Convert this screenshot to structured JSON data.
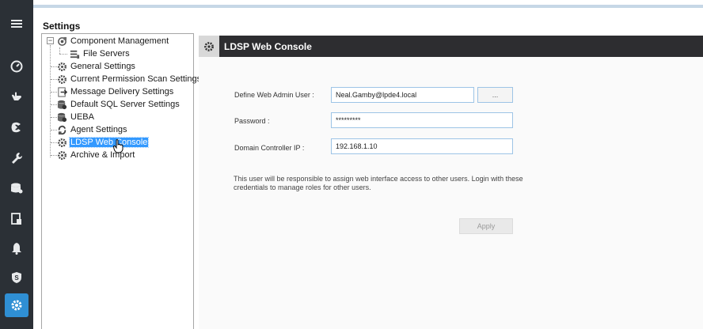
{
  "rail": {
    "items": [
      {
        "name": "menu-icon"
      },
      {
        "name": "dashboard-icon"
      },
      {
        "name": "hand-icon"
      },
      {
        "name": "scan-icon"
      },
      {
        "name": "wrench-icon"
      },
      {
        "name": "database-icon"
      },
      {
        "name": "report-icon"
      },
      {
        "name": "alert-bell-icon"
      },
      {
        "name": "shield-icon"
      },
      {
        "name": "settings-gear-icon",
        "active": true
      }
    ]
  },
  "header": {
    "title": "Settings"
  },
  "tree": {
    "items": [
      {
        "label": "Component Management",
        "icon": "component-icon"
      },
      {
        "label": "File Servers",
        "icon": "file-server-icon"
      },
      {
        "label": "General Settings",
        "icon": "gear-icon"
      },
      {
        "label": "Current Permission Scan Settings",
        "icon": "gear-icon"
      },
      {
        "label": "Message Delivery Settings",
        "icon": "message-icon"
      },
      {
        "label": "Default SQL Server Settings",
        "icon": "database-gear-icon"
      },
      {
        "label": "UEBA",
        "icon": "database-gear-icon"
      },
      {
        "label": "Agent Settings",
        "icon": "agent-icon"
      },
      {
        "label": "LDSP Web Console",
        "icon": "gear-icon",
        "selected": true
      },
      {
        "label": "Archive & Import",
        "icon": "gear-icon"
      }
    ]
  },
  "panel": {
    "title": "LDSP Web Console",
    "admin_user_label": "Define Web Admin User :",
    "admin_user_value": "Neal.Gamby@lpde4.local",
    "browse_label": "...",
    "password_label": "Password :",
    "password_value": "*********",
    "dc_ip_label": "Domain Controller IP :",
    "dc_ip_value": "192.168.1.10",
    "help_text": "This user will be responsible to assign web interface access to other users. Login with these credentials to manage roles for other users.",
    "apply_label": "Apply"
  },
  "colors": {
    "rail_bg": "#2b3036",
    "rail_active": "#2f8fd4",
    "panel_header_bg": "#2d2d30",
    "selection": "#3399ff",
    "field_border": "#9dc4e6"
  }
}
